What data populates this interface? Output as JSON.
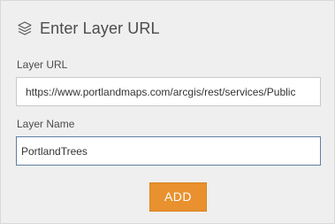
{
  "dialog": {
    "title": "Enter Layer URL",
    "title_icon": "layers-icon"
  },
  "form": {
    "url_label": "Layer URL",
    "url_value": "https://www.portlandmaps.com/arcgis/rest/services/Public",
    "name_label": "Layer Name",
    "name_value": "PortlandTrees"
  },
  "actions": {
    "add_label": "ADD"
  },
  "colors": {
    "accent": "#e8912e",
    "focus_border": "#5f7fa3",
    "panel_background": "#efefef"
  }
}
